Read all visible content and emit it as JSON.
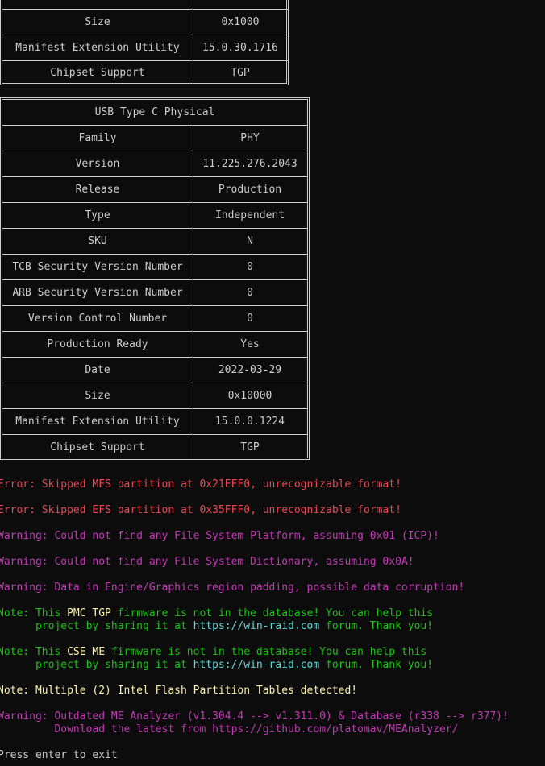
{
  "table_top": {
    "rows": [
      {
        "key": "Size",
        "value": "0x1000"
      },
      {
        "key": "Manifest Extension Utility",
        "value": "15.0.30.1716"
      },
      {
        "key": "Chipset Support",
        "value": "TGP"
      }
    ]
  },
  "table_usb": {
    "title": "USB Type C Physical",
    "rows": [
      {
        "key": "Family",
        "value": "PHY"
      },
      {
        "key": "Version",
        "value": "11.225.276.2043"
      },
      {
        "key": "Release",
        "value": "Production"
      },
      {
        "key": "Type",
        "value": "Independent"
      },
      {
        "key": "SKU",
        "value": "N"
      },
      {
        "key": "TCB Security Version Number",
        "value": "0"
      },
      {
        "key": "ARB Security Version Number",
        "value": "0"
      },
      {
        "key": "Version Control Number",
        "value": "0"
      },
      {
        "key": "Production Ready",
        "value": "Yes"
      },
      {
        "key": "Date",
        "value": "2022-03-29"
      },
      {
        "key": "Size",
        "value": "0x10000"
      },
      {
        "key": "Manifest Extension Utility",
        "value": "15.0.0.1224"
      },
      {
        "key": "Chipset Support",
        "value": "TGP"
      }
    ]
  },
  "messages": {
    "error1": "Error: Skipped MFS partition at 0x21EFF0, unrecognizable format!",
    "error2": "Error: Skipped EFS partition at 0x35FFF0, unrecognizable format!",
    "warn1": "Warning: Could not find any File System Platform, assuming 0x01 (ICP)!",
    "warn2": "Warning: Could not find any File System Dictionary, assuming 0x0A!",
    "warn3": "Warning: Data in Engine/Graphics region padding, possible data corruption!",
    "note1_prefix": "Note: This ",
    "note1_fw": "PMC TGP",
    "note1_mid": " firmware is not in the database! You can help this",
    "note1_line2_pre": "      project by sharing it at ",
    "note1_url": "https://win-raid.com",
    "note1_line2_post": " forum. Thank you!",
    "note2_prefix": "Note: This ",
    "note2_fw": "CSE ME",
    "note2_mid": " firmware is not in the database! You can help this",
    "note2_line2_pre": "      project by sharing it at ",
    "note2_url": "https://win-raid.com",
    "note2_line2_post": " forum. Thank you!",
    "note3": "Note: Multiple (2) Intel Flash Partition Tables detected!",
    "warn4_line1": "Warning: Outdated ME Analyzer (v1.304.4 --> v1.311.0) & Database (r338 --> r377)!",
    "warn4_line2": "         Download the latest from https://github.com/platomav/MEAnalyzer/",
    "prompt": "Press enter to exit"
  },
  "colors": {
    "background": "#0c0c0c",
    "text": "#cccccc",
    "error": "#e74856",
    "warning": "#c239b3",
    "note": "#16c60c",
    "highlight": "#f9f1a5",
    "url": "#61d6d6"
  }
}
